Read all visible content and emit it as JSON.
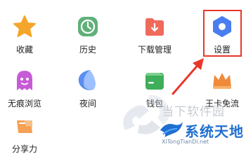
{
  "grid": {
    "items": [
      {
        "label": "收藏",
        "icon": "star-icon"
      },
      {
        "label": "历史",
        "icon": "clock-icon"
      },
      {
        "label": "下载管理",
        "icon": "download-folder-icon"
      },
      {
        "label": "设置",
        "icon": "settings-hexagon-icon"
      },
      {
        "label": "无痕浏览",
        "icon": "ghost-icon"
      },
      {
        "label": "夜间",
        "icon": "moon-icon"
      },
      {
        "label": "钱包",
        "icon": "wallet-icon"
      },
      {
        "label": "王卡免流",
        "icon": "crown-icon"
      },
      {
        "label": "分享力",
        "icon": "share-icon"
      }
    ]
  },
  "watermark": {
    "site_name": "当下软件园",
    "brand": "系统天地",
    "url": "XiTongTianDi.net"
  },
  "colors": {
    "highlight": "#e8372a",
    "star": "#f4a62a",
    "clock": "#5fb079",
    "download": "#ef6a5a",
    "settings": "#4a7ef0",
    "ghost": "#c75bd6",
    "moon": "#5b8ef0",
    "wallet": "#3fae5a",
    "crown": "#f08a3a",
    "share": "#f4a055"
  }
}
